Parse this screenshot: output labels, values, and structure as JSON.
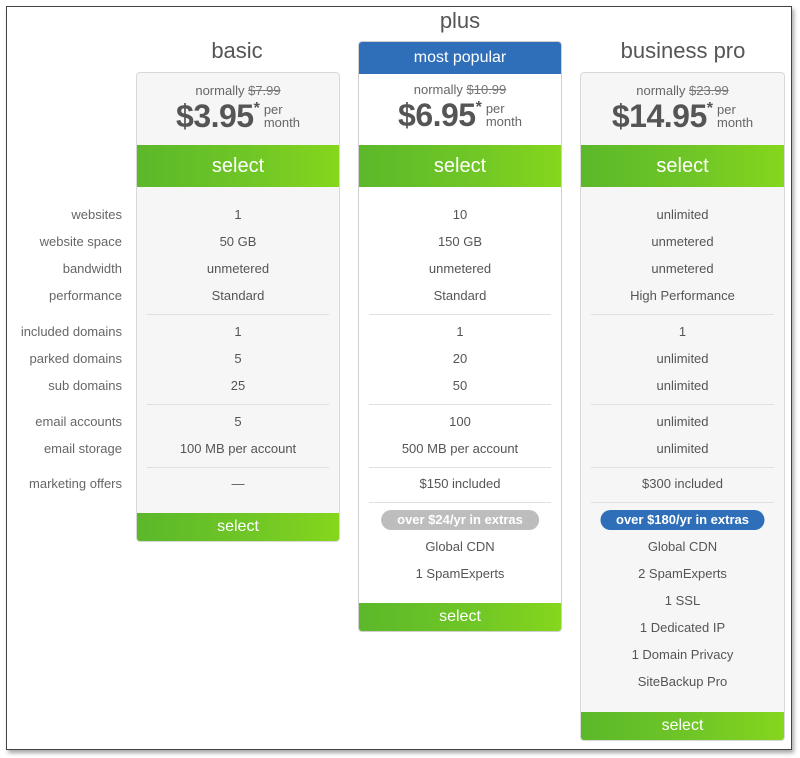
{
  "feature_labels": {
    "websites": "websites",
    "website_space": "website space",
    "bandwidth": "bandwidth",
    "performance": "performance",
    "included_domains": "included domains",
    "parked_domains": "parked domains",
    "sub_domains": "sub domains",
    "email_accounts": "email accounts",
    "email_storage": "email storage",
    "marketing_offers": "marketing offers"
  },
  "plans": {
    "basic": {
      "name": "basic",
      "normally_label": "normally",
      "original_price": "$7.99",
      "price": "$3.95",
      "asterisk": "*",
      "per": "per",
      "month": "month",
      "select_label": "select",
      "features": {
        "websites": "1",
        "website_space": "50 GB",
        "bandwidth": "unmetered",
        "performance": "Standard",
        "included_domains": "1",
        "parked_domains": "5",
        "sub_domains": "25",
        "email_accounts": "5",
        "email_storage": "100 MB per account",
        "marketing_offers": "—"
      }
    },
    "plus": {
      "name": "plus",
      "badge": "most popular",
      "normally_label": "normally",
      "original_price": "$10.99",
      "price": "$6.95",
      "asterisk": "*",
      "per": "per",
      "month": "month",
      "select_label": "select",
      "features": {
        "websites": "10",
        "website_space": "150 GB",
        "bandwidth": "unmetered",
        "performance": "Standard",
        "included_domains": "1",
        "parked_domains": "20",
        "sub_domains": "50",
        "email_accounts": "100",
        "email_storage": "500 MB per account",
        "marketing_offers": "$150 included"
      },
      "extras_badge": "over $24/yr in extras",
      "extras": [
        "Global CDN",
        "1 SpamExperts"
      ]
    },
    "business_pro": {
      "name": "business pro",
      "normally_label": "normally",
      "original_price": "$23.99",
      "price": "$14.95",
      "asterisk": "*",
      "per": "per",
      "month": "month",
      "select_label": "select",
      "features": {
        "websites": "unlimited",
        "website_space": "unmetered",
        "bandwidth": "unmetered",
        "performance": "High Performance",
        "included_domains": "1",
        "parked_domains": "unlimited",
        "sub_domains": "unlimited",
        "email_accounts": "unlimited",
        "email_storage": "unlimited",
        "marketing_offers": "$300 included"
      },
      "extras_badge": "over $180/yr in extras",
      "extras": [
        "Global CDN",
        "2 SpamExperts",
        "1 SSL",
        "1 Dedicated IP",
        "1 Domain Privacy",
        "SiteBackup Pro"
      ]
    }
  },
  "colors": {
    "select_green": "#6fc626",
    "badge_blue": "#2f6fba",
    "extras_gray": "#bdbdbd"
  }
}
